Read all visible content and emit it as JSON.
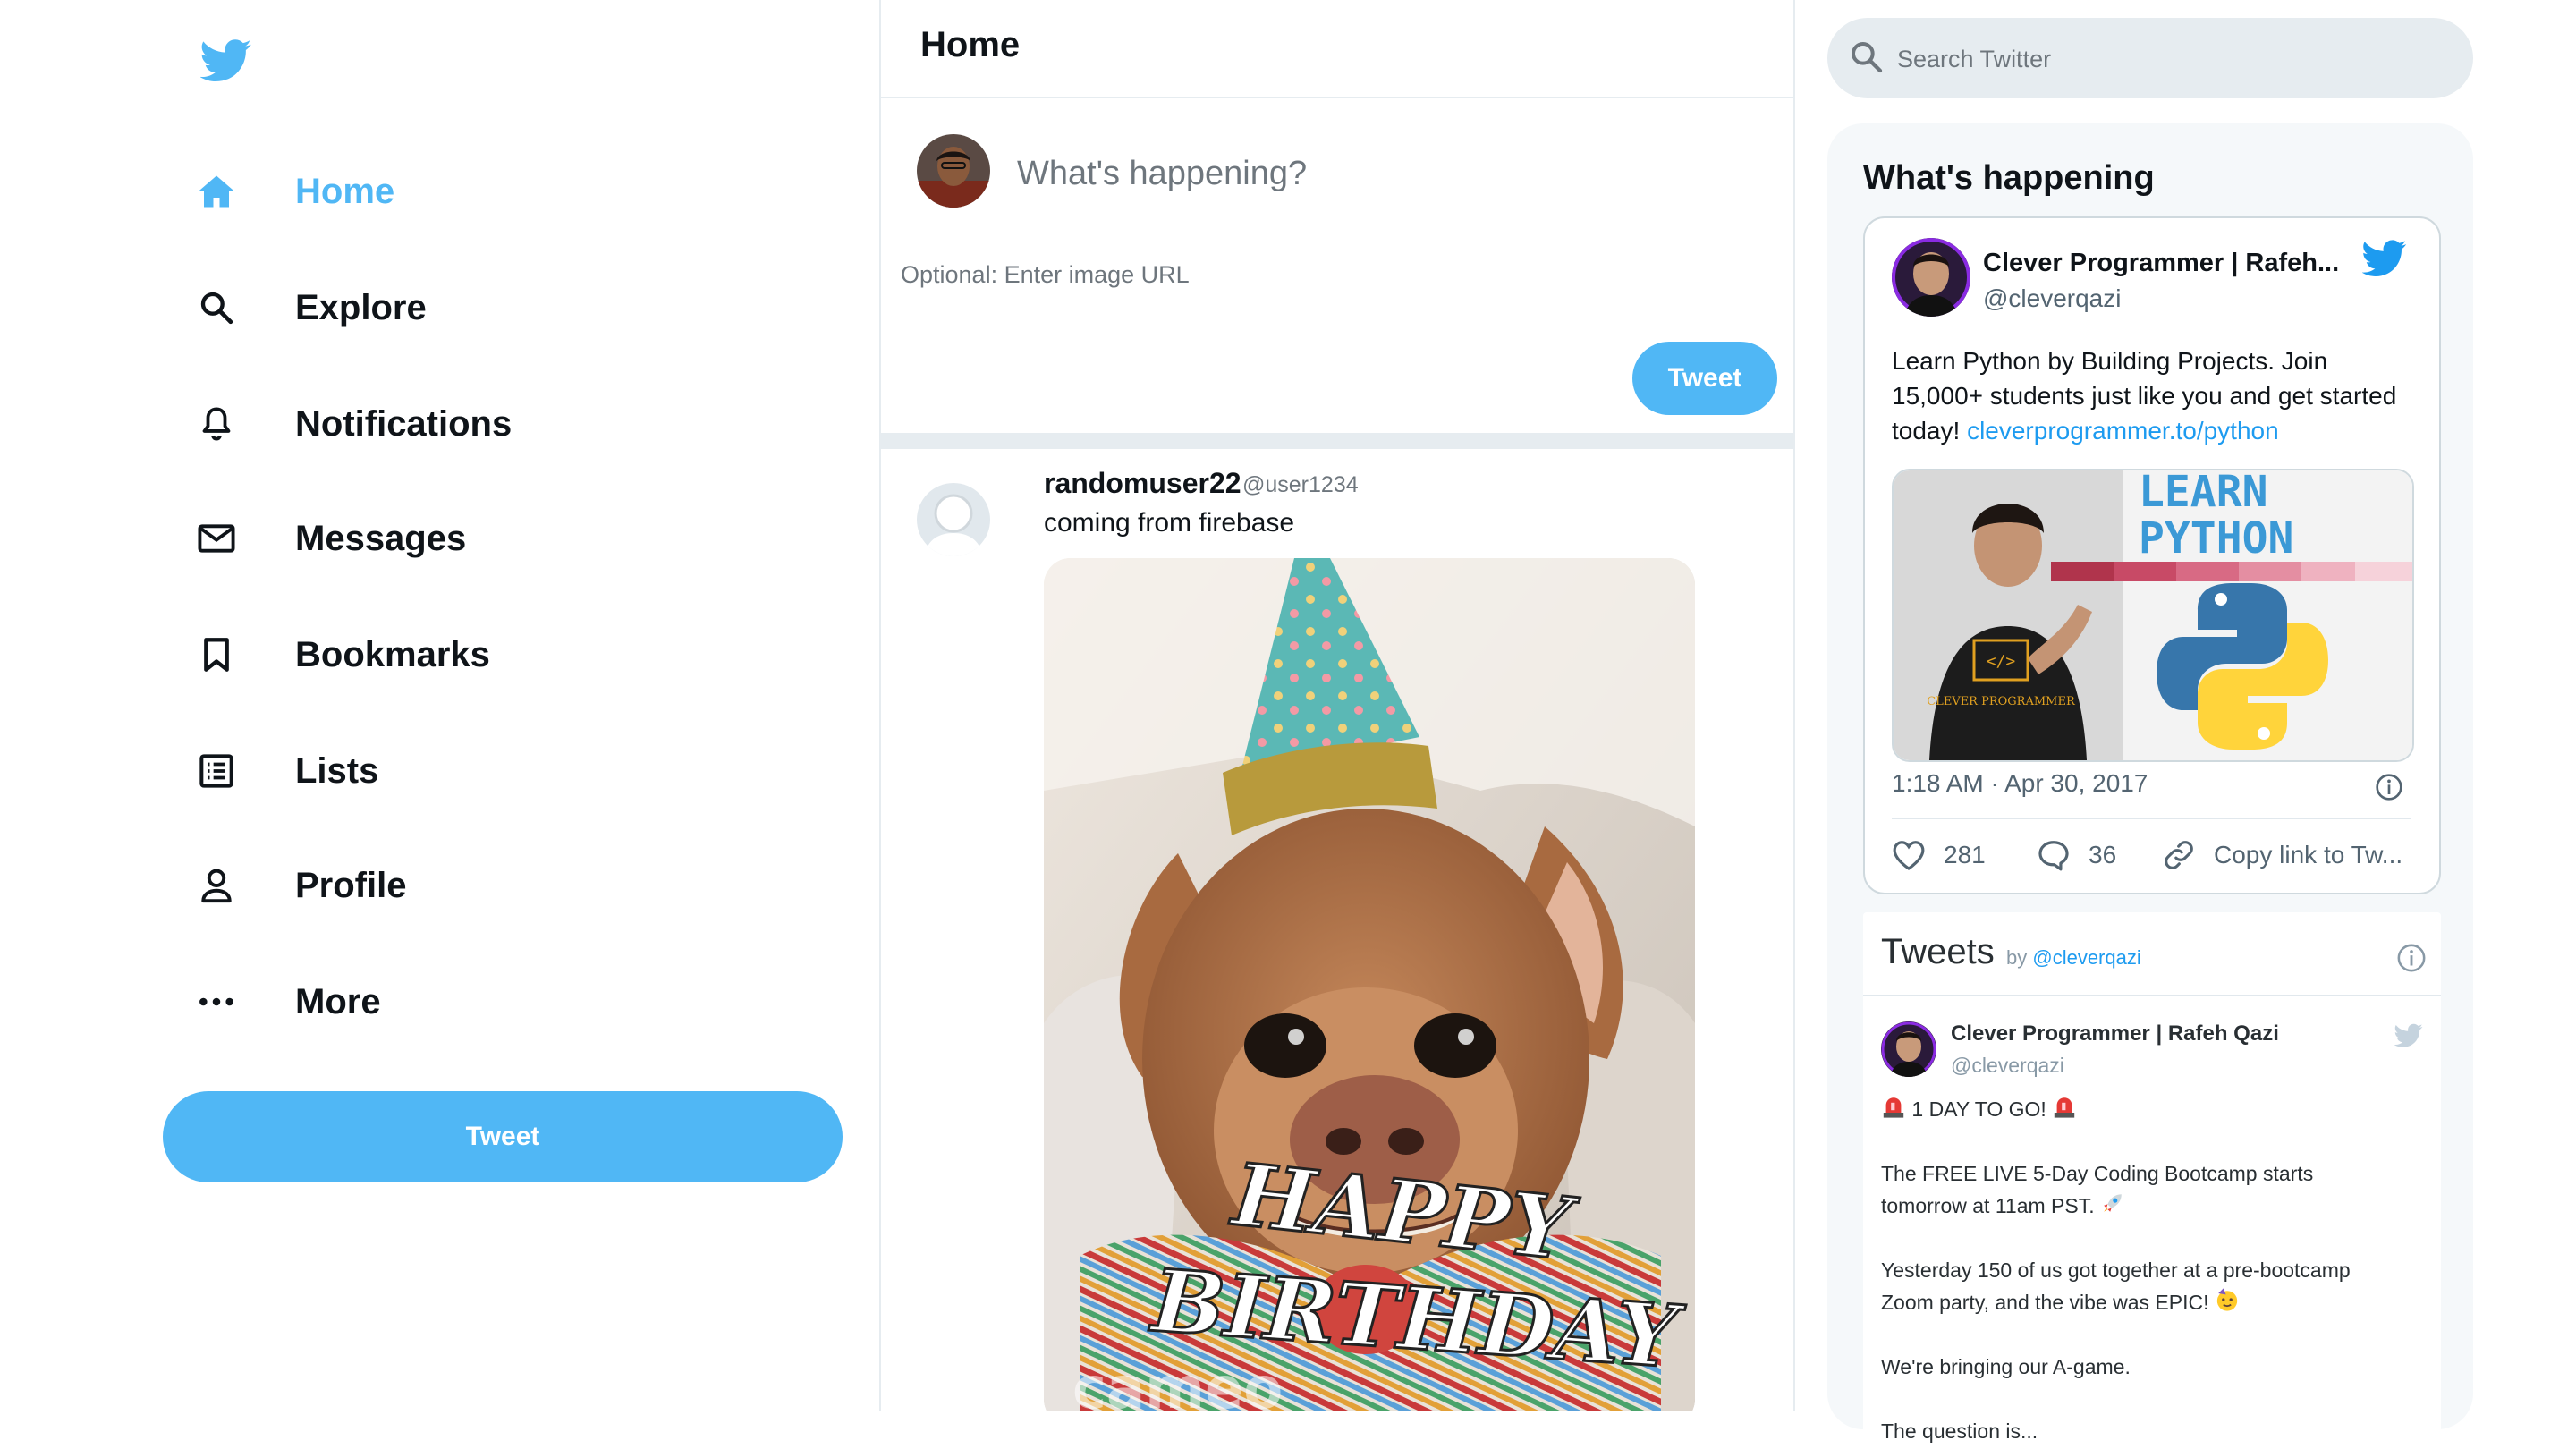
{
  "colors": {
    "accent": "#50b7f5",
    "link": "#1d9bf0",
    "text": "#0f1419",
    "muted": "#6e767d",
    "border": "#e6ecf0"
  },
  "sidebar": {
    "logo": "twitter-bird-icon",
    "items": [
      {
        "label": "Home",
        "icon": "home-icon",
        "active": true
      },
      {
        "label": "Explore",
        "icon": "search-icon"
      },
      {
        "label": "Notifications",
        "icon": "bell-icon"
      },
      {
        "label": "Messages",
        "icon": "mail-icon"
      },
      {
        "label": "Bookmarks",
        "icon": "bookmark-icon"
      },
      {
        "label": "Lists",
        "icon": "list-icon"
      },
      {
        "label": "Profile",
        "icon": "person-icon"
      },
      {
        "label": "More",
        "icon": "more-icon"
      }
    ],
    "tweet_button": "Tweet"
  },
  "feed": {
    "title": "Home",
    "compose": {
      "placeholder": "What's happening?",
      "image_placeholder": "Optional: Enter image URL",
      "button": "Tweet"
    },
    "post": {
      "display_name": "randomuser22",
      "handle": "@user1234",
      "text": "coming from firebase",
      "media": {
        "caption_line1": "HAPPY",
        "caption_line2": "BIRTHDAY",
        "watermark": "cameo"
      }
    }
  },
  "widgets": {
    "search_placeholder": "Search Twitter",
    "title": "What's happening",
    "embed": {
      "name": "Clever Programmer | Rafeh...",
      "handle": "@cleverqazi",
      "text": "Learn Python by Building Projects. Join 15,000+ students just like you and get started today! ",
      "link": "cleverprogrammer.to/python",
      "media": {
        "line1": "LEARN",
        "line2": "PYTHON",
        "shirt_code": "</>",
        "shirt_text": "CLEVER PROGRAMMER"
      },
      "timestamp": "1:18 AM · Apr 30, 2017",
      "likes": "281",
      "replies": "36",
      "copy_link": "Copy link to Tw..."
    },
    "timeline": {
      "title": "Tweets",
      "by_prefix": "by ",
      "by_handle": "@cleverqazi",
      "tweet": {
        "name": "Clever Programmer | Rafeh Qazi",
        "handle": "@cleverqazi",
        "line1": "1 DAY TO GO!",
        "line2": "The FREE LIVE 5-Day Coding Bootcamp starts",
        "line3": "tomorrow at 11am PST.",
        "line4": "Yesterday 150 of us got together at a pre-bootcamp",
        "line5": "Zoom party, and the vibe was EPIC!",
        "line6": "We're bringing our A-game.",
        "line7": "The question is..."
      }
    }
  }
}
